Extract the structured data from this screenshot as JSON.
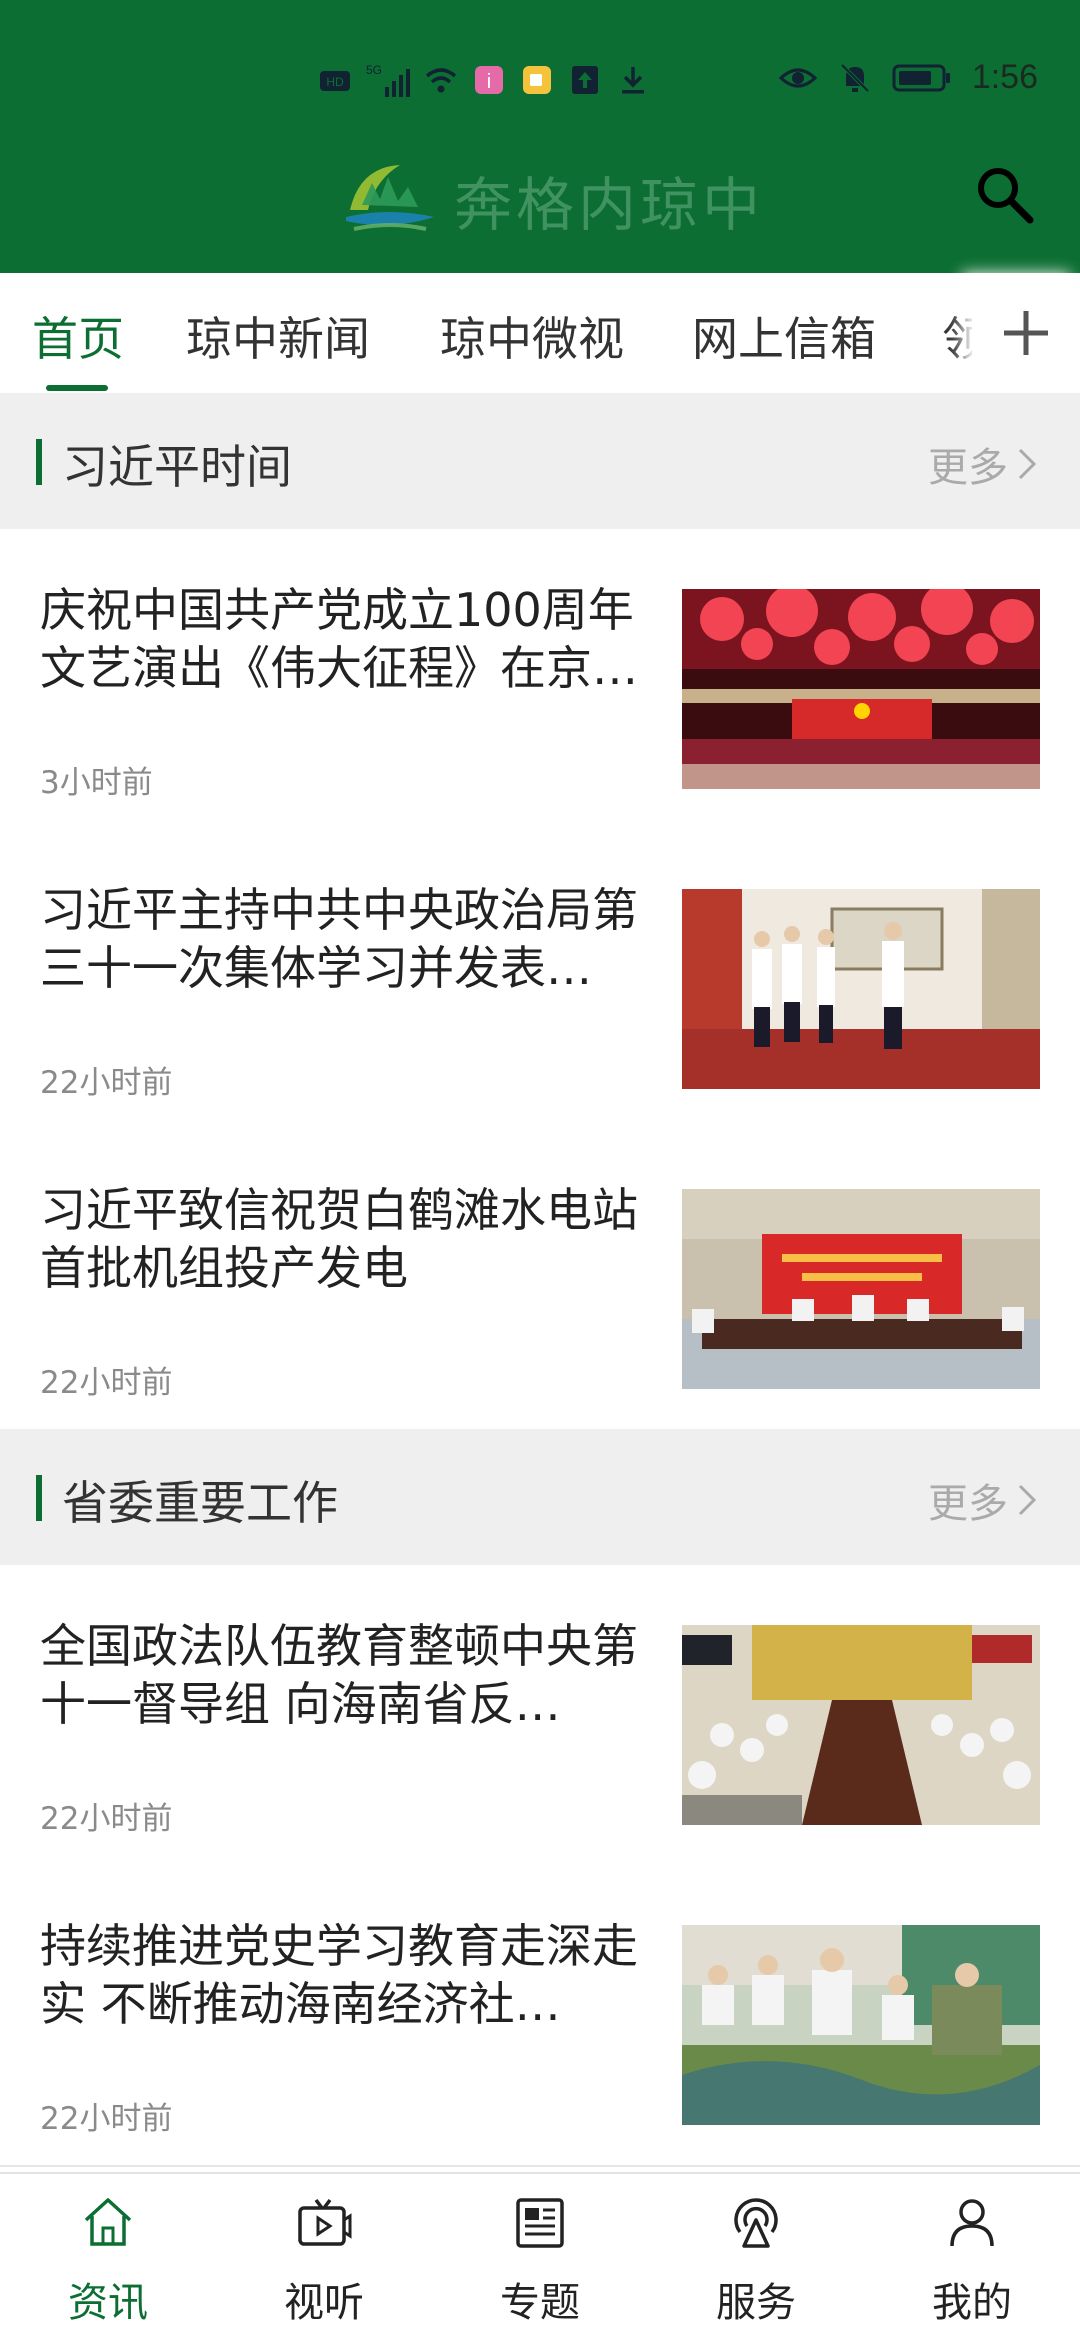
{
  "status_bar": {
    "network": "5G",
    "time": "1:56"
  },
  "app": {
    "logo_text": "奔格内琼中"
  },
  "tabs": [
    {
      "label": "首页",
      "active": true
    },
    {
      "label": "琼中新闻"
    },
    {
      "label": "琼中微视"
    },
    {
      "label": "网上信箱"
    },
    {
      "label": "领"
    }
  ],
  "sections": [
    {
      "title": "习近平时间",
      "more": "更多",
      "items": [
        {
          "title": "庆祝中国共产党成立100周年文艺演出《伟大征程》在京…",
          "time": "3小时前",
          "image": "fireworks-stage-photo"
        },
        {
          "title": "习近平主持中共中央政治局第三十一次集体学习并发表…",
          "time": "22小时前",
          "image": "exhibition-visit-photo"
        },
        {
          "title": "习近平致信祝贺白鹤滩水电站首批机组投产发电",
          "time": "22小时前",
          "image": "ceremony-meeting-photo"
        }
      ]
    },
    {
      "title": "省委重要工作",
      "more": "更多",
      "items": [
        {
          "title": "全国政法队伍教育整顿中央第十一督导组  向海南省反…",
          "time": "22小时前",
          "image": "conference-table-photo"
        },
        {
          "title": "持续推进党史学习教育走深走实  不断推动海南经济社…",
          "time": "22小时前",
          "image": "sandtable-inspection-photo"
        }
      ]
    }
  ],
  "bottom_nav": [
    {
      "label": "资讯",
      "icon": "home-icon",
      "active": true
    },
    {
      "label": "视听",
      "icon": "tv-play-icon"
    },
    {
      "label": "专题",
      "icon": "newspaper-icon"
    },
    {
      "label": "服务",
      "icon": "broadcast-icon"
    },
    {
      "label": "我的",
      "icon": "user-icon"
    }
  ],
  "colors": {
    "brand": "#0c6e32",
    "section_bg": "#efefef"
  }
}
